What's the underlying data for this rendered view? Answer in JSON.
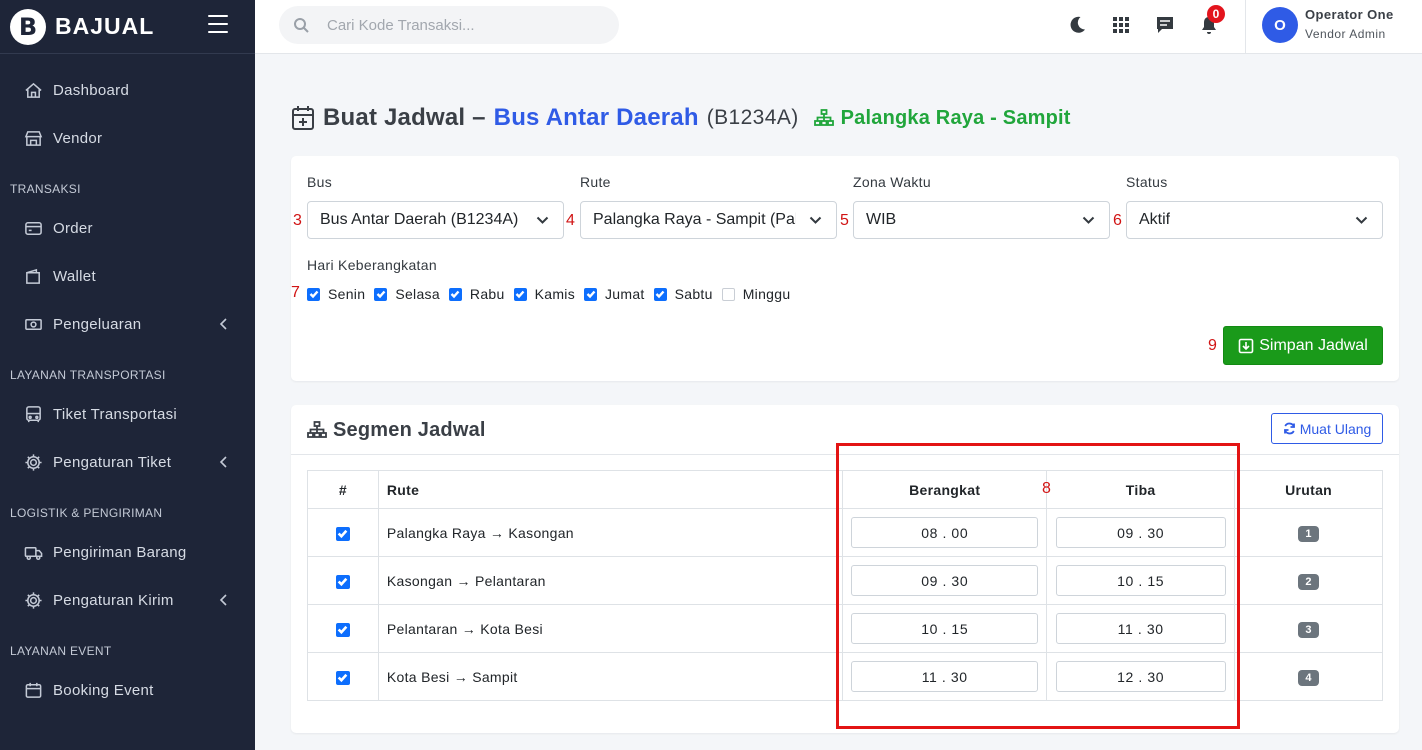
{
  "brand": {
    "name": "BAJUAL",
    "logo_letter": "B"
  },
  "sidebar": {
    "items_top": [
      {
        "label": "Dashboard",
        "icon": "home-icon"
      },
      {
        "label": "Vendor",
        "icon": "store-icon"
      }
    ],
    "sections": [
      {
        "header": "TRANSAKSI",
        "items": [
          {
            "label": "Order",
            "icon": "card-icon"
          },
          {
            "label": "Wallet",
            "icon": "wallet-icon"
          },
          {
            "label": "Pengeluaran",
            "icon": "money-icon",
            "chevron": true
          }
        ]
      },
      {
        "header": "LAYANAN TRANSPORTASI",
        "items": [
          {
            "label": "Tiket Transportasi",
            "icon": "bus-icon"
          },
          {
            "label": "Pengaturan Tiket",
            "icon": "gear-icon",
            "chevron": true
          }
        ]
      },
      {
        "header": "LOGISTIK & PENGIRIMAN",
        "items": [
          {
            "label": "Pengiriman Barang",
            "icon": "truck-icon"
          },
          {
            "label": "Pengaturan Kirim",
            "icon": "gear-icon",
            "chevron": true
          }
        ]
      },
      {
        "header": "LAYANAN EVENT",
        "items": [
          {
            "label": "Booking Event",
            "icon": "calendar-icon"
          }
        ]
      }
    ]
  },
  "topbar": {
    "search_placeholder": "Cari Kode Transaksi...",
    "notification_count": "0",
    "user": {
      "initial": "O",
      "name": "Operator One",
      "role": "Vendor Admin"
    }
  },
  "page": {
    "title_prefix": "Buat Jadwal –",
    "bus_name": "Bus Antar Daerah",
    "bus_code": "(B1234A)",
    "route_name": "Palangka Raya - Sampit"
  },
  "form": {
    "fields": [
      {
        "label": "Bus",
        "value": "Bus Antar Daerah (B1234A)",
        "annotation": "3"
      },
      {
        "label": "Rute",
        "value": "Palangka Raya - Sampit (Palangka Raya - Sampit)",
        "annotation": "4"
      },
      {
        "label": "Zona Waktu",
        "value": "WIB",
        "annotation": "5"
      },
      {
        "label": "Status",
        "value": "Aktif",
        "annotation": "6"
      }
    ],
    "days_label": "Hari Keberangkatan",
    "days_annotation": "7",
    "days": [
      {
        "label": "Senin",
        "checked": true
      },
      {
        "label": "Selasa",
        "checked": true
      },
      {
        "label": "Rabu",
        "checked": true
      },
      {
        "label": "Kamis",
        "checked": true
      },
      {
        "label": "Jumat",
        "checked": true
      },
      {
        "label": "Sabtu",
        "checked": true
      },
      {
        "label": "Minggu",
        "checked": false
      }
    ],
    "save_annotation": "9",
    "save_label": "Simpan Jadwal"
  },
  "segments": {
    "title": "Segmen Jadwal",
    "reload_label": "Muat Ulang",
    "annotation": "8",
    "headers": {
      "num": "#",
      "route": "Rute",
      "depart": "Berangkat",
      "arrive": "Tiba",
      "order": "Urutan"
    },
    "rows": [
      {
        "route": "Palangka Raya → Kasongan",
        "depart": "08 . 00",
        "arrive": "09 . 30",
        "order": "1",
        "checked": true
      },
      {
        "route": "Kasongan → Pelantaran",
        "depart": "09 . 30",
        "arrive": "10 . 15",
        "order": "2",
        "checked": true
      },
      {
        "route": "Pelantaran → Kota Besi",
        "depart": "10 . 15",
        "arrive": "11 . 30",
        "order": "3",
        "checked": true
      },
      {
        "route": "Kota Besi → Sampit",
        "depart": "11 . 30",
        "arrive": "12 . 30",
        "order": "4",
        "checked": true
      }
    ]
  },
  "colors": {
    "sidebar_bg": "#1e2538",
    "accent_blue": "#2f5be6",
    "route_green": "#21a63c",
    "save_green": "#1a9a1a",
    "annotation_red": "#d11414",
    "badge_red": "#e3141d"
  }
}
